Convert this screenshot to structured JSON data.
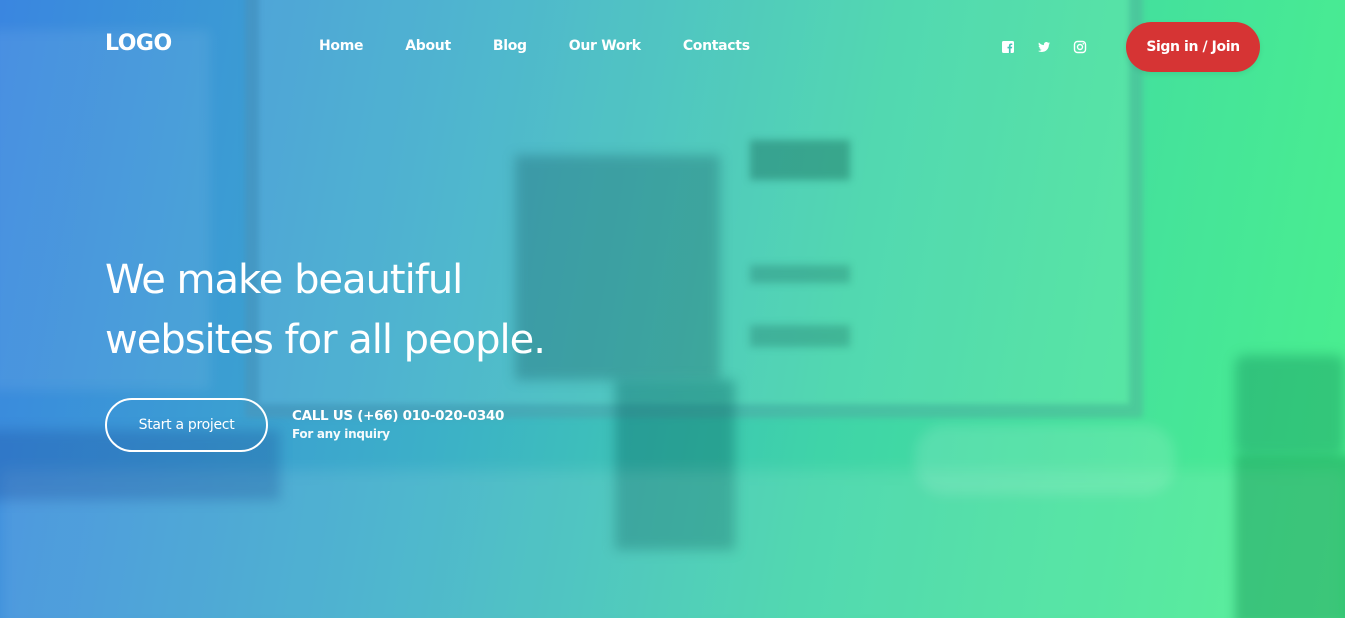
{
  "brand": {
    "logo_text": "LOGO"
  },
  "nav": {
    "items": [
      {
        "label": "Home"
      },
      {
        "label": "About"
      },
      {
        "label": "Blog"
      },
      {
        "label": "Our Work"
      },
      {
        "label": "Contacts"
      }
    ]
  },
  "social": {
    "icons": [
      "facebook-icon",
      "twitter-icon",
      "instagram-icon"
    ]
  },
  "header": {
    "signin_label": "Sign in / Join"
  },
  "hero": {
    "headline_line1": "We make beautiful",
    "headline_line2": "websites for all people.",
    "cta_label": "Start a project",
    "call_text": "CALL US (+66) 010-020-0340",
    "call_subtext": "For any inquiry"
  },
  "colors": {
    "signin_bg": "#d63434",
    "gradient_start": "#3a86e0",
    "gradient_end": "#4af08e",
    "text": "#ffffff"
  }
}
